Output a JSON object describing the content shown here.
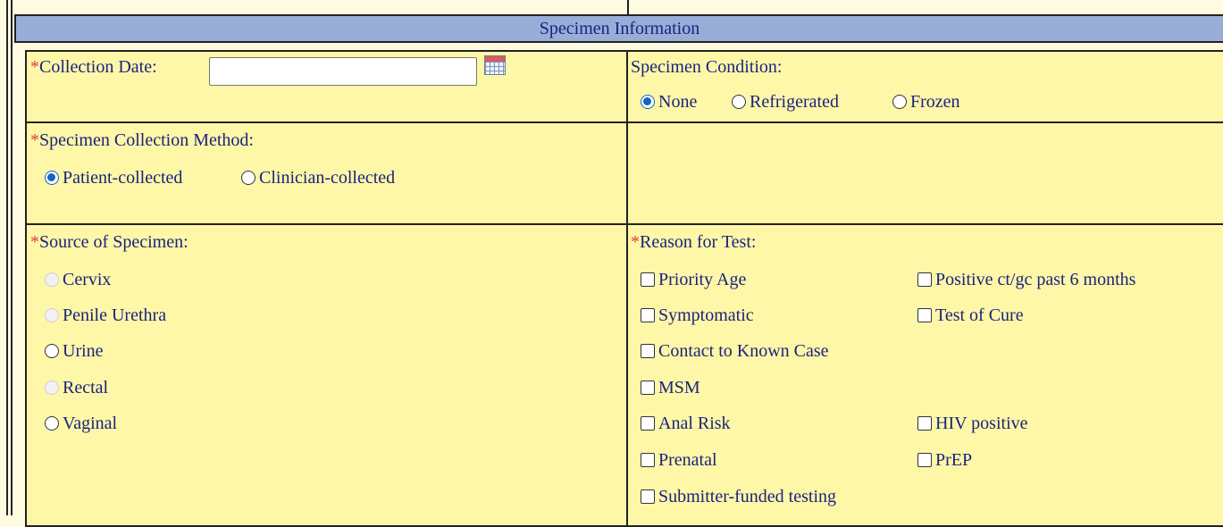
{
  "section": {
    "title": "Specimen Information"
  },
  "required_mark": "*",
  "collection_date": {
    "label": "Collection Date:",
    "value": "",
    "calendar_icon": "calendar-icon"
  },
  "specimen_condition": {
    "label": "Specimen Condition:",
    "options": [
      {
        "label": "None",
        "selected": true
      },
      {
        "label": "Refrigerated",
        "selected": false
      },
      {
        "label": "Frozen",
        "selected": false
      }
    ]
  },
  "collection_method": {
    "label": "Specimen Collection Method:",
    "options": [
      {
        "label": "Patient-collected",
        "selected": true
      },
      {
        "label": "Clinician-collected",
        "selected": false
      }
    ]
  },
  "source": {
    "label": "Source of Specimen:",
    "options": [
      {
        "label": "Cervix",
        "disabled": true
      },
      {
        "label": "Penile Urethra",
        "disabled": true
      },
      {
        "label": "Urine",
        "disabled": false
      },
      {
        "label": "Rectal",
        "disabled": true
      },
      {
        "label": "Vaginal",
        "disabled": false
      }
    ]
  },
  "reason": {
    "label": "Reason for Test:",
    "options": [
      {
        "label": "Priority Age"
      },
      {
        "label": "Positive ct/gc past 6 months"
      },
      {
        "label": "Symptomatic"
      },
      {
        "label": "Test of Cure"
      },
      {
        "label": "Contact to Known Case"
      },
      {
        "label": "MSM"
      },
      {
        "label": "Anal Risk"
      },
      {
        "label": "HIV positive"
      },
      {
        "label": "Prenatal"
      },
      {
        "label": "PrEP"
      },
      {
        "label": "Submitter-funded testing"
      }
    ]
  }
}
